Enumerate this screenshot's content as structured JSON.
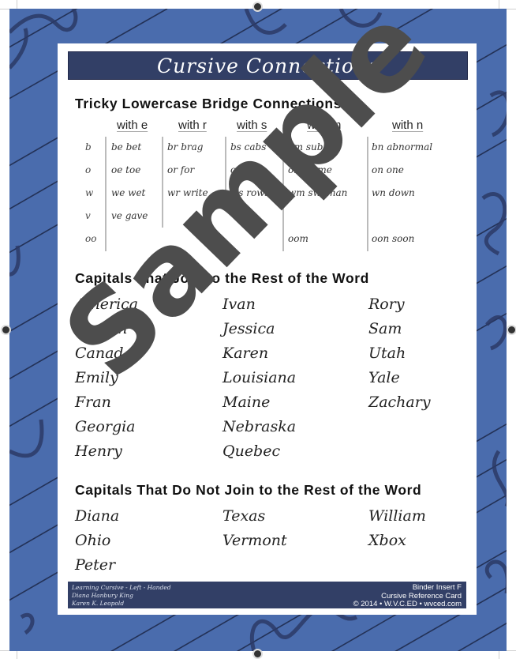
{
  "banner": {
    "title": "Cursive Connections"
  },
  "section1": {
    "heading": "Tricky Lowercase Bridge Connections",
    "columns": [
      "with e",
      "with r",
      "with s",
      "with m",
      "with n"
    ],
    "row_letters": [
      "b",
      "o",
      "w",
      "v",
      "oo"
    ],
    "cells": {
      "with_e": [
        "be bet",
        "oe toe",
        "we wet",
        "ve gave",
        ""
      ],
      "with_r": [
        "br brag",
        "or for",
        "wr write",
        "",
        ""
      ],
      "with_s": [
        "bs cabs",
        "os boss",
        "ws rows",
        "",
        ""
      ],
      "with_m": [
        "bm submit",
        "om home",
        "wm swoman",
        "",
        "oom"
      ],
      "with_n": [
        "bn abnormal",
        "on one",
        "wn down",
        "",
        "oon soon"
      ]
    }
  },
  "section2": {
    "heading": "Capitals That Join to the Rest of the Word",
    "col1": [
      "America",
      "Boston",
      "Canada",
      "Emily",
      "Fran",
      "Georgia",
      "Henry"
    ],
    "col2": [
      "Ivan",
      "Jessica",
      "Karen",
      "Louisiana",
      "Maine",
      "Nebraska",
      "Quebec"
    ],
    "col3": [
      "Rory",
      "Sam",
      "Utah",
      "Yale",
      "Zachary"
    ]
  },
  "section3": {
    "heading": "Capitals That Do Not Join to the Rest of the Word",
    "col1": [
      "Diana",
      "Ohio",
      "Peter"
    ],
    "col2": [
      "Texas",
      "Vermont"
    ],
    "col3": [
      "William",
      "Xbox"
    ]
  },
  "footer": {
    "left": [
      "Learning Cursive - Left - Handed",
      "Diana Hanbury King",
      "Karen K. Leopold"
    ],
    "right": [
      "Binder Insert F",
      "Cursive Reference Card",
      "© 2014 • W.V.C.ED • wvced.com"
    ]
  },
  "watermark": {
    "text": "Sample"
  },
  "colors": {
    "border_blue": "#4a6cad",
    "banner_navy": "#323f66",
    "watermark_gray": "#4d4d4d"
  }
}
